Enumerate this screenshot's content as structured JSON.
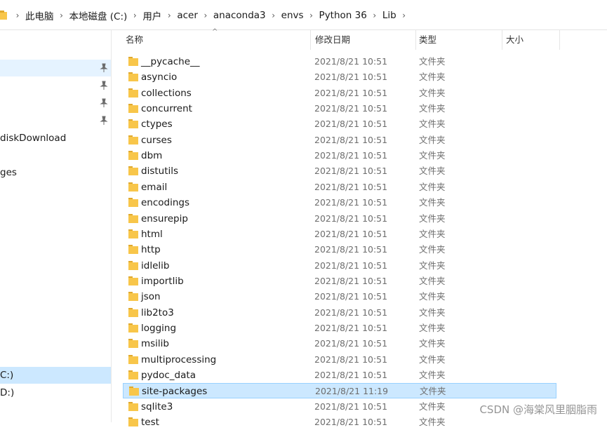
{
  "breadcrumb": {
    "items": [
      "此电脑",
      "本地磁盘 (C:)",
      "用户",
      "acer",
      "anaconda3",
      "envs",
      "Python 36",
      "Lib"
    ]
  },
  "nav": {
    "items": [
      {
        "label": "",
        "state": "selected",
        "pinned": true
      },
      {
        "label": "",
        "state": "",
        "pinned": true
      },
      {
        "label": "",
        "state": "",
        "pinned": true
      },
      {
        "label": "",
        "state": "",
        "pinned": true
      },
      {
        "label": "diskDownload",
        "state": "",
        "pinned": false
      },
      {
        "label": "ges",
        "state": "",
        "pinned": false
      },
      {
        "label": "C:)",
        "state": "drive-selected",
        "pinned": false
      },
      {
        "label": "D:)",
        "state": "",
        "pinned": false
      }
    ]
  },
  "columns": {
    "name": "名称",
    "date": "修改日期",
    "type": "类型",
    "size": "大小"
  },
  "files": [
    {
      "name": "__pycache__",
      "date": "2021/8/21 10:51",
      "type": "文件夹"
    },
    {
      "name": "asyncio",
      "date": "2021/8/21 10:51",
      "type": "文件夹"
    },
    {
      "name": "collections",
      "date": "2021/8/21 10:51",
      "type": "文件夹"
    },
    {
      "name": "concurrent",
      "date": "2021/8/21 10:51",
      "type": "文件夹"
    },
    {
      "name": "ctypes",
      "date": "2021/8/21 10:51",
      "type": "文件夹"
    },
    {
      "name": "curses",
      "date": "2021/8/21 10:51",
      "type": "文件夹"
    },
    {
      "name": "dbm",
      "date": "2021/8/21 10:51",
      "type": "文件夹"
    },
    {
      "name": "distutils",
      "date": "2021/8/21 10:51",
      "type": "文件夹"
    },
    {
      "name": "email",
      "date": "2021/8/21 10:51",
      "type": "文件夹"
    },
    {
      "name": "encodings",
      "date": "2021/8/21 10:51",
      "type": "文件夹"
    },
    {
      "name": "ensurepip",
      "date": "2021/8/21 10:51",
      "type": "文件夹"
    },
    {
      "name": "html",
      "date": "2021/8/21 10:51",
      "type": "文件夹"
    },
    {
      "name": "http",
      "date": "2021/8/21 10:51",
      "type": "文件夹"
    },
    {
      "name": "idlelib",
      "date": "2021/8/21 10:51",
      "type": "文件夹"
    },
    {
      "name": "importlib",
      "date": "2021/8/21 10:51",
      "type": "文件夹"
    },
    {
      "name": "json",
      "date": "2021/8/21 10:51",
      "type": "文件夹"
    },
    {
      "name": "lib2to3",
      "date": "2021/8/21 10:51",
      "type": "文件夹"
    },
    {
      "name": "logging",
      "date": "2021/8/21 10:51",
      "type": "文件夹"
    },
    {
      "name": "msilib",
      "date": "2021/8/21 10:51",
      "type": "文件夹"
    },
    {
      "name": "multiprocessing",
      "date": "2021/8/21 10:51",
      "type": "文件夹"
    },
    {
      "name": "pydoc_data",
      "date": "2021/8/21 10:51",
      "type": "文件夹"
    },
    {
      "name": "site-packages",
      "date": "2021/8/21 11:19",
      "type": "文件夹",
      "selected": true
    },
    {
      "name": "sqlite3",
      "date": "2021/8/21 10:51",
      "type": "文件夹"
    },
    {
      "name": "test",
      "date": "2021/8/21 10:51",
      "type": "文件夹"
    }
  ],
  "watermark": "CSDN @海棠风里胭脂雨",
  "colors": {
    "folder": "#f8c64a",
    "selection_bg": "#cce8ff",
    "selection_border": "#99d1ff",
    "hover_bg": "#e5f3ff"
  }
}
